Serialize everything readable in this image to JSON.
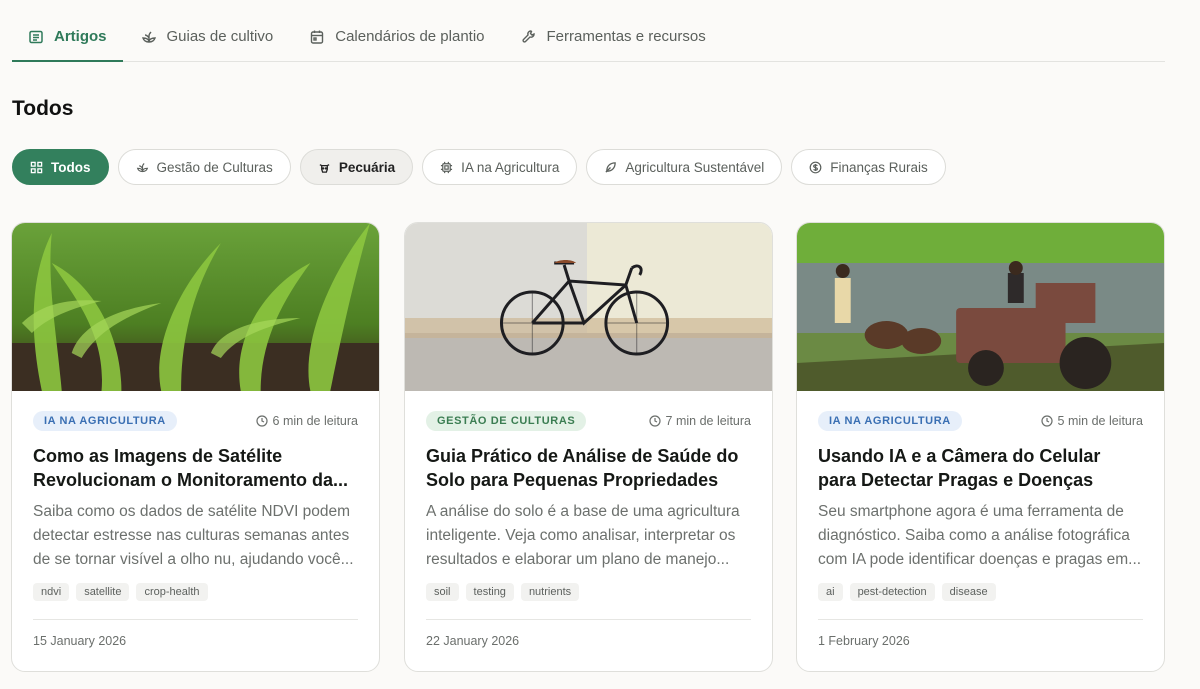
{
  "tabs": [
    {
      "label": "Artigos",
      "icon": "list-icon",
      "active": true
    },
    {
      "label": "Guias de cultivo",
      "icon": "plant-icon"
    },
    {
      "label": "Calendários de plantio",
      "icon": "calendar-icon"
    },
    {
      "label": "Ferramentas e recursos",
      "icon": "wrench-icon"
    }
  ],
  "section_title": "Todos",
  "chips": [
    {
      "label": "Todos",
      "icon": "grid-icon",
      "state": "active"
    },
    {
      "label": "Gestão de Culturas",
      "icon": "plant-icon"
    },
    {
      "label": "Pecuária",
      "icon": "cow-icon",
      "state": "hover"
    },
    {
      "label": "IA na Agricultura",
      "icon": "cpu-icon"
    },
    {
      "label": "Agricultura Sustentável",
      "icon": "leaf-icon"
    },
    {
      "label": "Finanças Rurais",
      "icon": "dollar-icon"
    }
  ],
  "cards": [
    {
      "category": "IA NA AGRICULTURA",
      "read_time": "6 min de leitura",
      "title": "Como as Imagens de Satélite Revolucionam o Monitoramento da Saúde das Culturas",
      "excerpt": "Saiba como os dados de satélite NDVI podem detectar estresse nas culturas semanas antes de se tornar visível a olho nu, ajudando você a agir rapidamente.",
      "tags": [
        "ndvi",
        "satellite",
        "crop-health"
      ],
      "date": "15 January 2026"
    },
    {
      "category": "GESTÃO DE CULTURAS",
      "read_time": "7 min de leitura",
      "title": "Guia Prático de Análise de Saúde do Solo para Pequenas Propriedades",
      "excerpt": "A análise do solo é a base de uma agricultura inteligente. Veja como analisar, interpretar os resultados e elaborar um plano de manejo sem complicação.",
      "tags": [
        "soil",
        "testing",
        "nutrients"
      ],
      "date": "22 January 2026"
    },
    {
      "category": "IA NA AGRICULTURA",
      "read_time": "5 min de leitura",
      "title": "Usando IA e a Câmera do Celular para Detectar Pragas e Doenças",
      "excerpt": "Seu smartphone agora é uma ferramenta de diagnóstico. Saiba como a análise fotográfica com IA pode identificar doenças e pragas em segundos.",
      "tags": [
        "ai",
        "pest-detection",
        "disease"
      ],
      "date": "1 February 2026"
    }
  ],
  "colors": {
    "accent": "#33805d",
    "blue_badge": "#3a6fb3",
    "green_badge": "#3b7d52"
  }
}
